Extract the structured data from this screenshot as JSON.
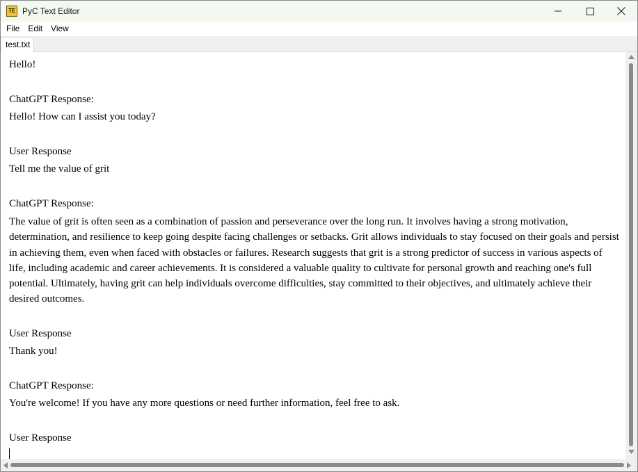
{
  "app": {
    "title": "PyC Text Editor",
    "icon": "text-editor-icon",
    "icon_glyph": "TE"
  },
  "window_controls": {
    "minimize_icon": "minimize-icon",
    "maximize_icon": "maximize-icon",
    "close_icon": "close-icon"
  },
  "menu": {
    "items": [
      {
        "label": "File"
      },
      {
        "label": "Edit"
      },
      {
        "label": "View"
      }
    ]
  },
  "tabs": [
    {
      "label": "test.txt",
      "active": true
    }
  ],
  "editor": {
    "lines": [
      "Hello!",
      "",
      "ChatGPT Response:",
      "Hello! How can I assist you today?",
      "",
      "User Response",
      "Tell me the value of grit",
      "",
      "ChatGPT Response:",
      "The value of grit is often seen as a combination of passion and perseverance over the long run. It involves having a strong motivation, determination, and resilience to keep going despite facing challenges or setbacks. Grit allows individuals to stay focused on their goals and persist in achieving them, even when faced with obstacles or failures. Research suggests that grit is a strong predictor of success in various aspects of life, including academic and career achievements. It is considered a valuable quality to cultivate for personal growth and reaching one's full potential. Ultimately, having grit can help individuals overcome difficulties, stay committed to their objectives, and ultimately achieve their desired outcomes.",
      "",
      "User Response",
      "Thank you!",
      "",
      "ChatGPT Response:",
      "You're welcome! If you have any more questions or need further information, feel free to ask.",
      "",
      "User Response",
      ""
    ]
  },
  "colors": {
    "titlebar_bg": "#f3f9f1",
    "scrollbar_thumb": "#8a8a8a"
  }
}
